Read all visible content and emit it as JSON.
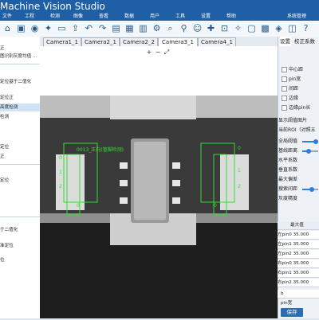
{
  "title": "Machine Vision Studio",
  "menu": [
    "文件",
    "工程",
    "检测",
    "图像",
    "查看",
    "数据",
    "用户",
    "工具",
    "设置",
    "帮助",
    "系统管理"
  ],
  "toolbar_icons": [
    "home-icon",
    "save-icon",
    "camera-icon",
    "settings-icon",
    "folder-icon",
    "upload-icon",
    "undo-icon",
    "redo-icon",
    "image-icon",
    "grid-icon",
    "chart-icon",
    "gear-icon",
    "search-icon",
    "pin-icon",
    "user-icon",
    "plugin-icon",
    "lock-icon",
    "bulb-icon",
    "monitor-icon",
    "calendar-icon",
    "tag-icon",
    "layers-icon",
    "crop-icon",
    "list-icon",
    "help-icon"
  ],
  "left_panel": {
    "items": [
      "正",
      "图识别灰度均值 ...",
      "",
      "定位基于二值化",
      "定位正",
      "高度检测",
      "检测",
      "",
      "定位",
      "正",
      "定位",
      "",
      "",
      "",
      "",
      "",
      "于二值化",
      "",
      "",
      "",
      "准定位",
      "",
      "",
      "",
      "位"
    ],
    "selected_index": 4
  },
  "tabs": [
    "Camera1_1",
    "Camera2_1",
    "Camera2_2",
    "Camera3_1",
    "Camera4_1"
  ],
  "active_tab": 3,
  "view_toolbar": [
    "+",
    "−",
    "⤢"
  ],
  "image": {
    "roi_labels": [
      "0",
      "1",
      "2"
    ],
    "roi_title": "0013_正向(管脚检测)",
    "roi_left_caption": "0",
    "roi_right_caption": "0"
  },
  "right_panel": {
    "tabs": [
      "设置",
      "校正系数"
    ],
    "active_tab": 0,
    "checkboxes": [
      "中心距",
      "pin宽",
      "间距",
      "边缘",
      "边缘pin长"
    ],
    "show_threshold": "显示阈值图片",
    "current_roi": "当前ROI（对照五",
    "sliders": [
      {
        "label": "全局阈值",
        "value": 0.78
      },
      {
        "label": "基线距离",
        "value": 0.35
      },
      {
        "label": "水平系数",
        "value": 0.0
      },
      {
        "label": "垂直系数",
        "value": 0.0
      },
      {
        "label": "最大偏差",
        "value": 0.0
      },
      {
        "label": "搜索间距",
        "value": 0.55
      },
      {
        "label": "灰度精度",
        "value": 0.0
      }
    ],
    "table_header": "最大值",
    "table_rows": [
      {
        "label": "左pin0",
        "value": "35.000"
      },
      {
        "label": "左pin1",
        "value": "35.000"
      },
      {
        "label": "左pin2",
        "value": "35.000"
      },
      {
        "label": "右pin0",
        "value": "35.000"
      },
      {
        "label": "右pin1",
        "value": "35.000"
      },
      {
        "label": "右pin2",
        "value": "35.000"
      }
    ],
    "sub_value": "b",
    "field_label": "pin宽",
    "save": "保存"
  }
}
